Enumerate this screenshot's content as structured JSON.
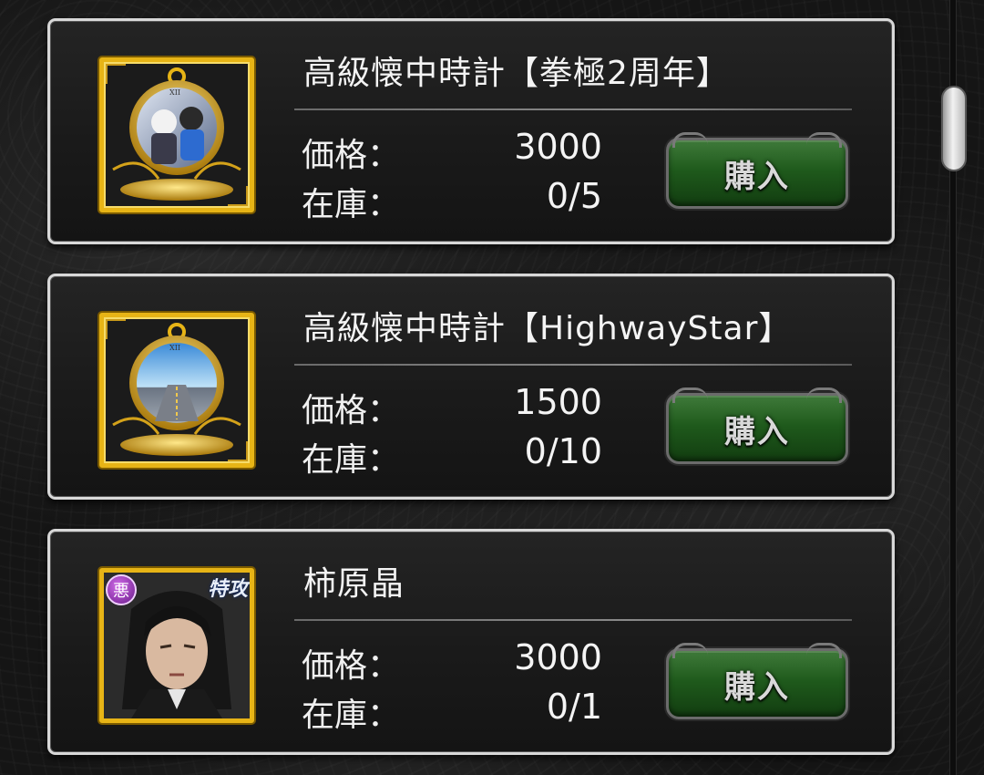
{
  "items": [
    {
      "name": "高級懐中時計【拳極2周年】",
      "price_label": "価格：",
      "price": "3000",
      "stock_label": "在庫：",
      "stock": "0/5",
      "buy_label": "購入",
      "icon": "pocket-watch-icon"
    },
    {
      "name": "高級懐中時計【HighwayStar】",
      "price_label": "価格：",
      "price": "1500",
      "stock_label": "在庫：",
      "stock": "0/10",
      "buy_label": "購入",
      "icon": "pocket-watch-icon"
    },
    {
      "name": "柿原晶",
      "price_label": "価格：",
      "price": "3000",
      "stock_label": "在庫：",
      "stock": "0/1",
      "buy_label": "購入",
      "icon": "character-portrait",
      "attribute_badge": "悪",
      "rank_badge": "特攻"
    }
  ],
  "colors": {
    "frame_gold": "#e7b416",
    "buy_green": "#1f5a1c",
    "card_border": "#d8d8d8"
  }
}
